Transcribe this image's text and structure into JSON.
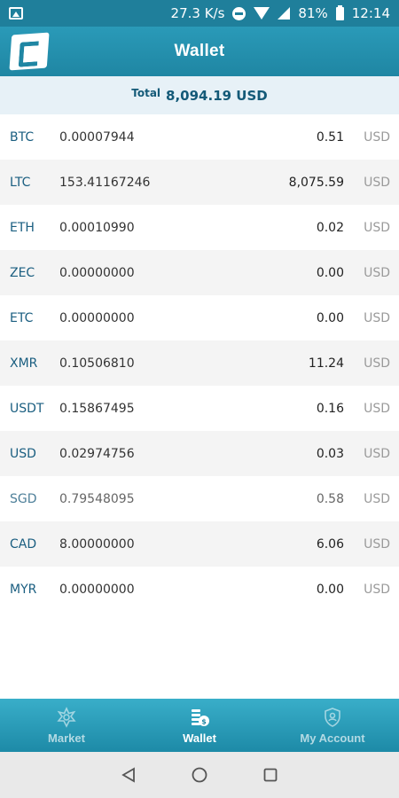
{
  "status_bar": {
    "speed": "27.3 K/s",
    "battery": "81%",
    "time": "12:14"
  },
  "header": {
    "title": "Wallet",
    "logo_icon": "app-logo-c"
  },
  "total": {
    "label": "Total",
    "value": "8,094.19 USD"
  },
  "wallet": {
    "rows": [
      {
        "symbol": "BTC",
        "amount": "0.00007944",
        "value": "0.51",
        "currency": "USD"
      },
      {
        "symbol": "LTC",
        "amount": "153.41167246",
        "value": "8,075.59",
        "currency": "USD"
      },
      {
        "symbol": "ETH",
        "amount": "0.00010990",
        "value": "0.02",
        "currency": "USD"
      },
      {
        "symbol": "ZEC",
        "amount": "0.00000000",
        "value": "0.00",
        "currency": "USD"
      },
      {
        "symbol": "ETC",
        "amount": "0.00000000",
        "value": "0.00",
        "currency": "USD"
      },
      {
        "symbol": "XMR",
        "amount": "0.10506810",
        "value": "11.24",
        "currency": "USD"
      },
      {
        "symbol": "USDT",
        "amount": "0.15867495",
        "value": "0.16",
        "currency": "USD"
      },
      {
        "symbol": "USD",
        "amount": "0.02974756",
        "value": "0.03",
        "currency": "USD"
      },
      {
        "symbol": "SGD",
        "amount": "0.79548095",
        "value": "0.58",
        "currency": "USD"
      },
      {
        "symbol": "CAD",
        "amount": "8.00000000",
        "value": "6.06",
        "currency": "USD"
      },
      {
        "symbol": "MYR",
        "amount": "0.00000000",
        "value": "0.00",
        "currency": "USD"
      }
    ]
  },
  "bottom_nav": {
    "items": [
      {
        "label": "Market",
        "icon": "market-icon"
      },
      {
        "label": "Wallet",
        "icon": "wallet-icon"
      },
      {
        "label": "My Account",
        "icon": "account-shield-icon"
      }
    ],
    "active": "Wallet"
  },
  "colors": {
    "primary": "#1f86a3",
    "status_bar": "#1f7f9b",
    "total_bg": "#e7f1f7",
    "symbol_text": "#1a5e80"
  }
}
